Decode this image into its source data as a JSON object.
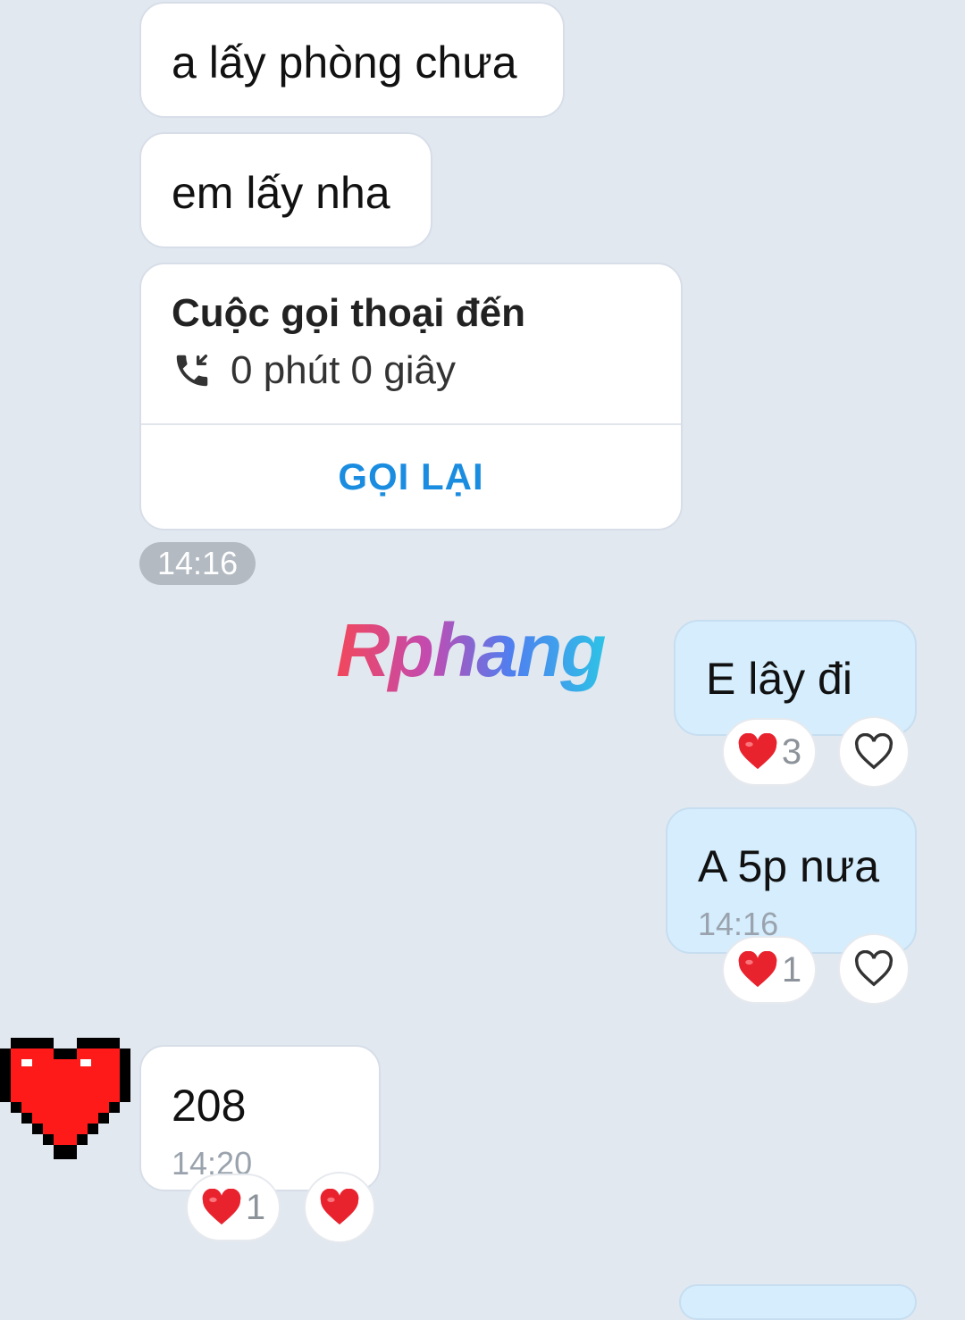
{
  "messages": {
    "m1": {
      "text": "a lấy phòng chưa"
    },
    "m2": {
      "text": "em lấy nha"
    },
    "call": {
      "title": "Cuộc gọi thoại đến",
      "duration": "0 phút 0 giây",
      "icon": "incoming-call-icon",
      "action_label": "GỌI LẠI"
    },
    "time_chip": "14:16",
    "m3": {
      "text": "E lây đi",
      "reaction_count": "3",
      "reaction_icon": "heart-icon"
    },
    "m4": {
      "text": "A 5p nưa",
      "time": "14:16",
      "reaction_count": "1",
      "reaction_icon": "heart-icon"
    },
    "m5": {
      "text": "208",
      "time": "14:20",
      "reaction_count": "1",
      "reaction_icon": "heart-icon",
      "my_reaction": "heart-icon"
    }
  },
  "watermark": "Rphang",
  "avatar": {
    "icon": "pixel-heart-avatar-icon"
  },
  "colors": {
    "background": "#e2e8f0",
    "incoming_bubble": "#ffffff",
    "outgoing_bubble": "#d5edfd",
    "accent": "#1a8de0",
    "heart": "#e8232e"
  }
}
